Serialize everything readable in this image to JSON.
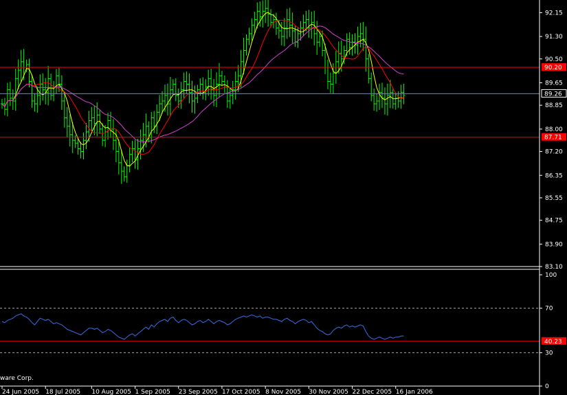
{
  "copyright": "ware Corp.",
  "chart_data": [
    {
      "type": "ohlc",
      "panel": "price",
      "background": "#000000",
      "bar_color": "#00ff00",
      "price_axis": {
        "ticks": [
          "92.15",
          "91.30",
          "90.50",
          "89.65",
          "88.85",
          "88.00",
          "87.20",
          "86.35",
          "85.55",
          "84.75",
          "83.90",
          "83.10"
        ],
        "ylim": [
          83.1,
          92.6
        ]
      },
      "date_axis": {
        "labels": [
          "24 Jun 2005",
          "18 Jul 2005",
          "10 Aug 2005",
          "1 Sep 2005",
          "23 Sep 2005",
          "17 Oct 2005",
          "8 Nov 2005",
          "30 Nov 2005",
          "22 Dec 2005",
          "16 Jan 2006"
        ],
        "label_bar_index": [
          0,
          16,
          33,
          49,
          65,
          81,
          97,
          113,
          129,
          145
        ]
      },
      "closes": [
        88.9,
        88.7,
        89.4,
        89.1,
        89.0,
        89.8,
        90.1,
        90.4,
        90.2,
        90.3,
        89.7,
        89.0,
        88.9,
        89.2,
        89.6,
        89.4,
        89.3,
        89.8,
        89.2,
        89.5,
        89.9,
        89.6,
        89.0,
        88.4,
        88.1,
        87.8,
        87.6,
        87.5,
        87.3,
        87.2,
        87.6,
        87.9,
        88.3,
        88.4,
        88.2,
        88.5,
        88.0,
        87.6,
        87.9,
        88.3,
        88.0,
        87.6,
        87.2,
        86.8,
        86.5,
        86.3,
        86.7,
        87.1,
        87.3,
        86.9,
        87.3,
        87.6,
        87.8,
        88.1,
        87.7,
        88.4,
        88.1,
        88.6,
        88.9,
        89.0,
        89.2,
        88.9,
        89.4,
        89.6,
        89.2,
        89.0,
        89.4,
        89.7,
        89.6,
        89.3,
        89.0,
        89.1,
        89.4,
        89.6,
        89.3,
        89.5,
        89.8,
        89.4,
        89.2,
        89.6,
        89.9,
        89.7,
        89.5,
        89.0,
        89.2,
        89.4,
        89.7,
        89.9,
        90.4,
        90.8,
        91.2,
        91.4,
        91.7,
        91.9,
        92.2,
        92.0,
        92.2,
        92.3,
        92.1,
        91.8,
        91.9,
        91.6,
        91.5,
        91.3,
        91.6,
        91.9,
        91.7,
        91.5,
        91.1,
        91.4,
        91.6,
        91.8,
        91.9,
        91.6,
        91.8,
        91.4,
        91.1,
        91.3,
        90.8,
        90.2,
        89.7,
        89.6,
        90.0,
        90.4,
        90.7,
        90.5,
        90.8,
        91.2,
        90.9,
        91.1,
        91.0,
        91.3,
        91.4,
        91.2,
        90.5,
        89.8,
        89.2,
        88.9,
        89.0,
        89.3,
        89.1,
        88.9,
        89.2,
        89.3,
        88.9,
        89.1,
        89.0,
        89.3,
        89.2
      ],
      "moving_averages": [
        {
          "period": 5,
          "color": "#ffff00"
        },
        {
          "period": 12,
          "color": "#ff0000"
        },
        {
          "period": 28,
          "color": "#cc44cc"
        }
      ],
      "horizontal_lines": [
        {
          "value": 90.2,
          "label": "90.20",
          "color": "#ff0000",
          "label_bg": "#ff0000"
        },
        {
          "value": 87.71,
          "label": "87.71",
          "color": "#ff0000",
          "label_bg": "#ff0000"
        },
        {
          "value": 89.26,
          "label": "89.26",
          "color": "#7a8aa0",
          "label_bg": "#000000"
        }
      ]
    },
    {
      "type": "line",
      "panel": "oscillator",
      "series_color": "#3a6ee8",
      "y_axis": {
        "ticks": [
          "100",
          "70",
          "30",
          "0"
        ],
        "ylim": [
          0,
          100
        ]
      },
      "dashed_levels": [
        70,
        30
      ],
      "horizontal_lines": [
        {
          "value": 40.23,
          "label": "40.23",
          "color": "#ff0000",
          "label_bg": "#ff0000"
        }
      ],
      "values": [
        58,
        57,
        59,
        60,
        61,
        63,
        64,
        65,
        63,
        62,
        60,
        57,
        55,
        58,
        61,
        60,
        59,
        60,
        58,
        56,
        57,
        56,
        55,
        53,
        51,
        50,
        49,
        48,
        47,
        46,
        48,
        50,
        52,
        52,
        51,
        52,
        50,
        48,
        49,
        51,
        50,
        48,
        46,
        44,
        43,
        42,
        44,
        46,
        47,
        45,
        47,
        49,
        51,
        53,
        51,
        55,
        53,
        56,
        58,
        59,
        60,
        58,
        61,
        62,
        59,
        57,
        59,
        60,
        59,
        57,
        55,
        56,
        58,
        59,
        57,
        58,
        60,
        58,
        56,
        58,
        59,
        58,
        57,
        55,
        56,
        58,
        60,
        61,
        62,
        63,
        62,
        63,
        64,
        63,
        62,
        63,
        61,
        62,
        62,
        61,
        60,
        60,
        59,
        58,
        60,
        61,
        59,
        58,
        56,
        58,
        59,
        60,
        59,
        57,
        58,
        55,
        52,
        50,
        49,
        47,
        46,
        47,
        50,
        52,
        53,
        52,
        54,
        55,
        53,
        54,
        53,
        54,
        55,
        54,
        49,
        45,
        43,
        42,
        43,
        44,
        43,
        42,
        43,
        44,
        43,
        44,
        44,
        45,
        45
      ]
    }
  ]
}
